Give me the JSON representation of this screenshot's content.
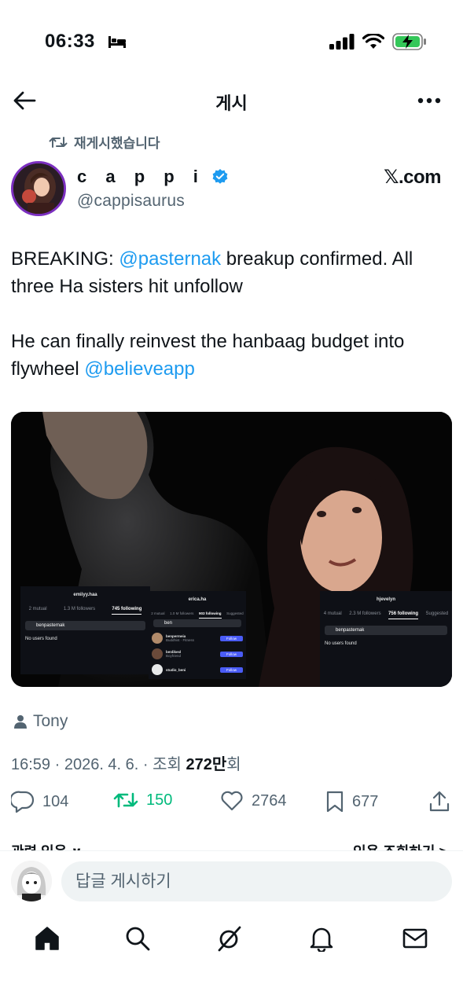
{
  "status_bar": {
    "time": "06:33",
    "battery_color": "#34c759"
  },
  "nav": {
    "title": "게시",
    "back_icon": "arrow-left-icon",
    "more_icon": "more-horizontal-icon"
  },
  "repost": {
    "label": "재게시했습니다"
  },
  "author": {
    "name": "c a p p i",
    "handle": "@cappisaurus",
    "verified": true,
    "source_label": "𝕏.com"
  },
  "tweet": {
    "line1_prefix": "BREAKING: ",
    "line1_mention": "@pasternak",
    "line1_suffix": " breakup confirmed. All three Ha sisters hit unfollow",
    "line2_prefix": "He can finally reinvest the hanbaag budget into flywheel ",
    "line2_mention": "@believeapp"
  },
  "media": {
    "panels": [
      {
        "header": "emiiyy.haa",
        "tabs": [
          "2 mutual",
          "1.3 M followers",
          "745 following"
        ],
        "active_tab": 2,
        "search": "benpasternak",
        "result": "No users found"
      },
      {
        "header": "erica.ha",
        "tabs": [
          "2 mutual",
          "1.0 M followers",
          "903 following",
          "Suggested"
        ],
        "active_tab": 2,
        "search": "ben",
        "results": [
          {
            "name": "benpermeia",
            "sub": "Buddhist · Fitness",
            "button": "Follow"
          },
          {
            "name": "benlikesl",
            "sub": "Boyfriend",
            "button": "Follow"
          },
          {
            "name": "studio_beni",
            "sub": "",
            "button": "Follow"
          }
        ]
      },
      {
        "header": "hjevelyn",
        "tabs": [
          "4 mutual",
          "2.3 M followers",
          "756 following",
          "Suggested"
        ],
        "active_tab": 2,
        "search": "benpasternak",
        "result": "No users found"
      }
    ]
  },
  "meta": {
    "user_label": "Tony",
    "timestamp": "16:59 · 2026. 4. 6. · 조회 ",
    "views": "272만",
    "views_suffix": "회"
  },
  "actions": {
    "replies": "104",
    "reposts": "150",
    "likes": "2764",
    "bookmarks": "677"
  },
  "related": {
    "left": "관련 있음 ∨",
    "right": "인용 조회하기 >"
  },
  "reply": {
    "placeholder": "답글 게시하기"
  },
  "tabbar": {
    "icons": [
      "home-icon",
      "search-icon",
      "grok-icon",
      "bell-icon",
      "mail-icon"
    ]
  }
}
